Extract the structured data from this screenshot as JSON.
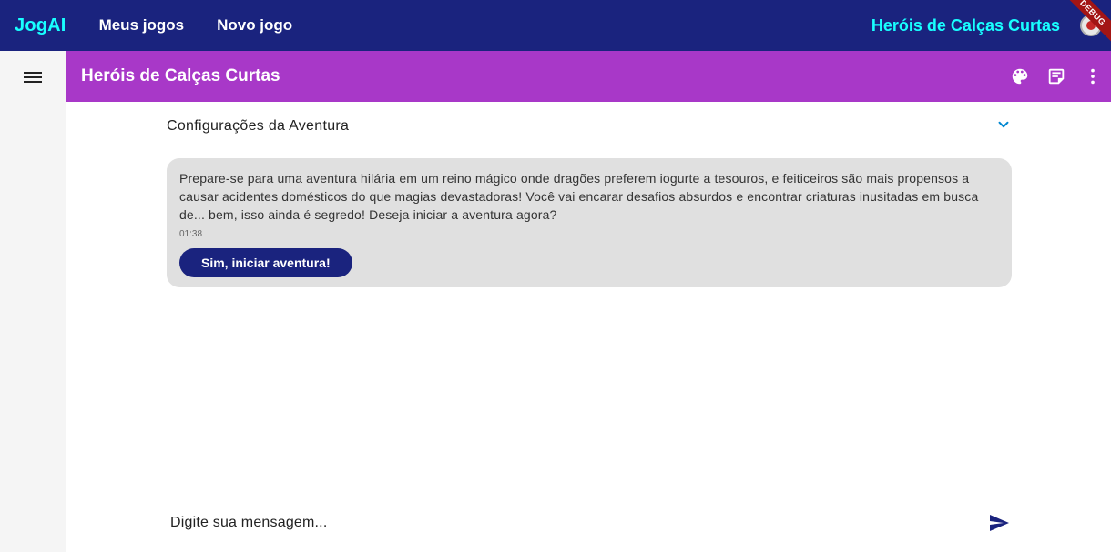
{
  "topbar": {
    "brand": "JogAI",
    "nav": [
      "Meus jogos",
      "Novo jogo"
    ],
    "game_title": "Heróis de Calças Curtas",
    "debug_label": "DEBUG"
  },
  "appbar": {
    "title": "Heróis de Calças Curtas",
    "icons": [
      "palette-icon",
      "notes-icon",
      "more-vert-icon"
    ]
  },
  "sidebar": {
    "menu_icon": "menu-icon"
  },
  "content": {
    "settings_label": "Configurações da Aventura",
    "message": {
      "text": "Prepare-se para uma aventura hilária em um reino mágico onde dragões preferem iogurte a tesouros, e feiticeiros são mais propensos a causar acidentes domésticos do que magias devastadoras!  Você vai encarar desafios absurdos e encontrar criaturas inusitadas em busca de... bem, isso ainda é segredo! Deseja iniciar a aventura agora?",
      "time": "01:38",
      "action_label": "Sim, iniciar aventura!"
    },
    "input": {
      "placeholder": "Digite sua mensagem..."
    }
  },
  "colors": {
    "topbar": "#1a237e",
    "brand": "#18ffff",
    "appbar": "#a838c8",
    "bubble": "#e0e0e0",
    "accent": "#0288d1"
  }
}
